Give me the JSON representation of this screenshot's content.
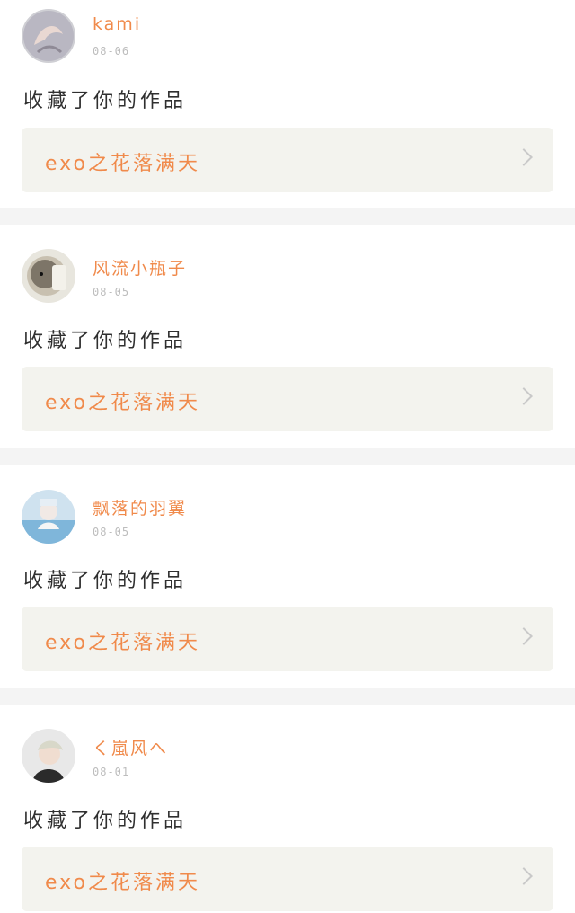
{
  "items": [
    {
      "username": "kami",
      "date": "08-06",
      "action": "收藏了你的作品",
      "work": "exo之花落满天"
    },
    {
      "username": "风流小瓶子",
      "date": "08-05",
      "action": "收藏了你的作品",
      "work": "exo之花落满天"
    },
    {
      "username": "飘落的羽翼",
      "date": "08-05",
      "action": "收藏了你的作品",
      "work": "exo之花落满天"
    },
    {
      "username": "く嵐风へ",
      "date": "08-01",
      "action": "收藏了你的作品",
      "work": "exo之花落满天"
    }
  ],
  "colors": {
    "accent": "#f08a4b",
    "text": "#2f2f2f",
    "meta": "#bdbdbd",
    "box": "#f3f3ee",
    "divider": "#f4f4f4"
  }
}
